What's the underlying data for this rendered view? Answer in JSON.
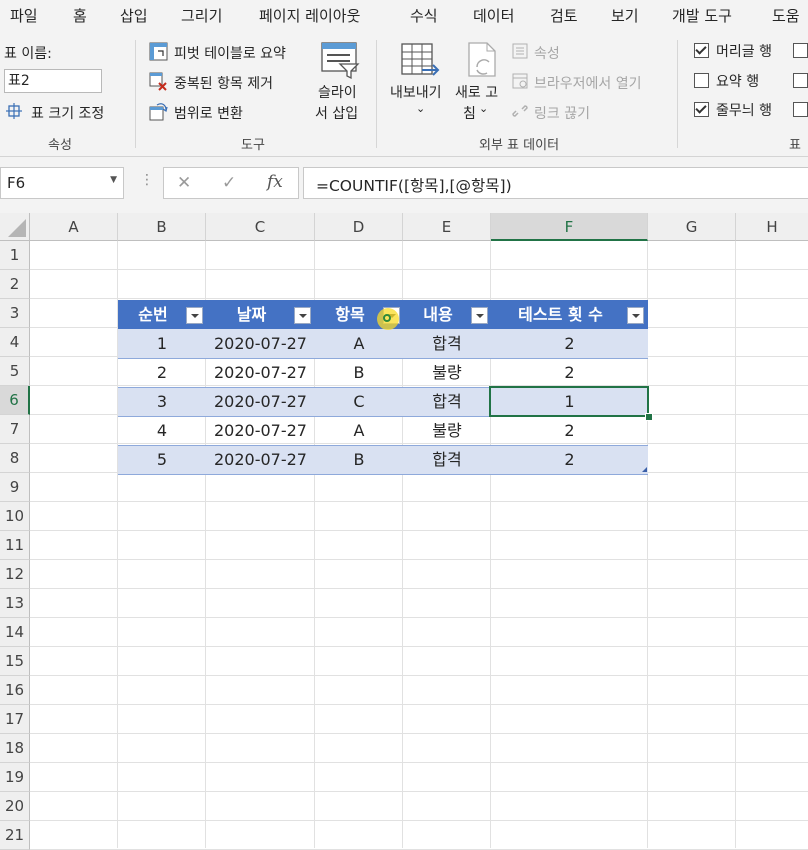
{
  "menu": [
    "파일",
    "홈",
    "삽입",
    "그리기",
    "페이지 레이아웃",
    "수식",
    "데이터",
    "검토",
    "보기",
    "개발 도구",
    "도움"
  ],
  "ribbon": {
    "properties": {
      "table_name_label": "표 이름:",
      "table_name_value": "표2",
      "resize_label": "표 크기 조정",
      "group_label": "속성"
    },
    "tools": {
      "pivot_label": "피벗 테이블로 요약",
      "remove_dup_label": "중복된 항목 제거",
      "convert_label": "범위로 변환",
      "slicer_line1": "슬라이",
      "slicer_line2": "서 삽입",
      "group_label": "도구"
    },
    "external": {
      "export_label": "내보내기",
      "refresh_line1": "새로 고",
      "refresh_line2": "침",
      "properties_label": "속성",
      "open_browser_label": "브라우저에서 열기",
      "unlink_label": "링크 끊기",
      "group_label": "외부 표 데이터"
    },
    "style_options": {
      "header_row_label": "머리글 행",
      "header_row_checked": true,
      "total_row_label": "요약 행",
      "total_row_checked": false,
      "banded_rows_label": "줄무늬 행",
      "banded_rows_checked": true,
      "group_label": "표"
    }
  },
  "formula_bar": {
    "name_box": "F6",
    "cancel_icon": "✕",
    "enter_icon": "✓",
    "fx_label": "fx",
    "formula": "=COUNTIF([항목],[@항목])"
  },
  "grid": {
    "columns": [
      "A",
      "B",
      "C",
      "D",
      "E",
      "F",
      "G",
      "H"
    ],
    "selected_column": "F",
    "rows": [
      "1",
      "2",
      "3",
      "4",
      "5",
      "6",
      "7",
      "8",
      "9",
      "10",
      "11",
      "12",
      "13",
      "14",
      "15",
      "16",
      "17",
      "18",
      "19",
      "20",
      "21"
    ],
    "selected_row": "6"
  },
  "table": {
    "headers": [
      "순번",
      "날짜",
      "항목",
      "내용",
      "테스트 횟 수"
    ],
    "rows": [
      [
        "1",
        "2020-07-27",
        "A",
        "합격",
        "2"
      ],
      [
        "2",
        "2020-07-27",
        "B",
        "불량",
        "2"
      ],
      [
        "3",
        "2020-07-27",
        "C",
        "합격",
        "1"
      ],
      [
        "4",
        "2020-07-27",
        "A",
        "불량",
        "2"
      ],
      [
        "5",
        "2020-07-27",
        "B",
        "합격",
        "2"
      ]
    ],
    "header_color": "#4472c4",
    "band_color": "#d9e1f2"
  },
  "selection_color": "#217346"
}
